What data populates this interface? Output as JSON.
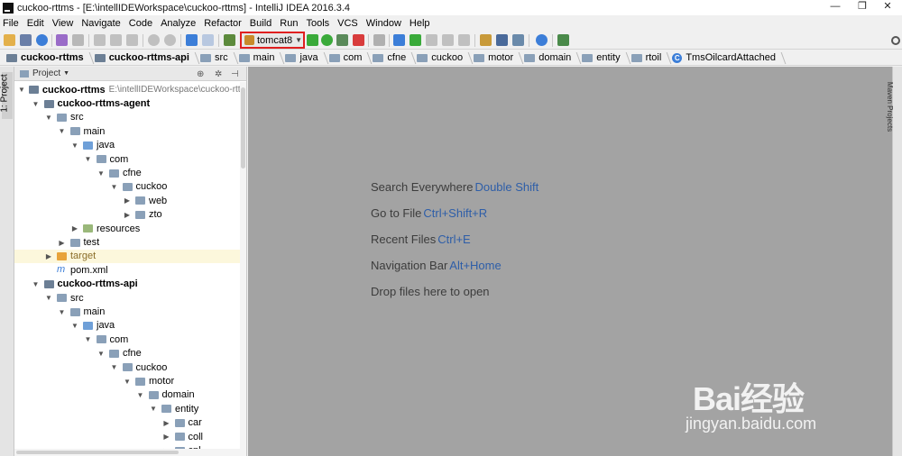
{
  "window": {
    "title": "cuckoo-rttms - [E:\\intellIDEWorkspace\\cuckoo-rttms] - IntelliJ IDEA 2016.3.4",
    "controls": [
      "—",
      "❐",
      "✕"
    ]
  },
  "menu": [
    "File",
    "Edit",
    "View",
    "Navigate",
    "Code",
    "Analyze",
    "Refactor",
    "Build",
    "Run",
    "Tools",
    "VCS",
    "Window",
    "Help"
  ],
  "toolbar": {
    "run_config": "tomcat8",
    "accent": "#e02020"
  },
  "breadcrumbs": [
    {
      "label": "cuckoo-rttms",
      "bold": true,
      "icon": "project-folder-icon"
    },
    {
      "label": "cuckoo-rttms-api",
      "bold": true,
      "icon": "module-folder-icon"
    },
    {
      "label": "src",
      "icon": "folder-icon"
    },
    {
      "label": "main",
      "icon": "folder-icon"
    },
    {
      "label": "java",
      "icon": "source-folder-icon"
    },
    {
      "label": "com",
      "icon": "folder-icon"
    },
    {
      "label": "cfne",
      "icon": "folder-icon"
    },
    {
      "label": "cuckoo",
      "icon": "folder-icon"
    },
    {
      "label": "motor",
      "icon": "folder-icon"
    },
    {
      "label": "domain",
      "icon": "folder-icon"
    },
    {
      "label": "entity",
      "icon": "folder-icon"
    },
    {
      "label": "rtoil",
      "icon": "folder-icon"
    },
    {
      "label": "TmsOilcardAttached",
      "icon": "class-icon"
    }
  ],
  "left_tool_window": {
    "tab_label": "1: Project"
  },
  "project_panel": {
    "header": "Project",
    "tree": [
      {
        "label": "cuckoo-rttms",
        "path": "E:\\intellIDEWorkspace\\cuckoo-rttms",
        "indent": 0,
        "expanded": true,
        "bold": true,
        "icon": "mod"
      },
      {
        "label": "cuckoo-rttms-agent",
        "indent": 1,
        "expanded": true,
        "bold": true,
        "icon": "mod"
      },
      {
        "label": "src",
        "indent": 2,
        "expanded": true,
        "icon": "folder"
      },
      {
        "label": "main",
        "indent": 3,
        "expanded": true,
        "icon": "folder"
      },
      {
        "label": "java",
        "indent": 4,
        "expanded": true,
        "icon": "src"
      },
      {
        "label": "com",
        "indent": 5,
        "expanded": true,
        "icon": "folder"
      },
      {
        "label": "cfne",
        "indent": 6,
        "expanded": true,
        "icon": "folder"
      },
      {
        "label": "cuckoo",
        "indent": 7,
        "expanded": true,
        "icon": "folder"
      },
      {
        "label": "web",
        "indent": 8,
        "expanded": false,
        "icon": "folder"
      },
      {
        "label": "zto",
        "indent": 8,
        "expanded": false,
        "icon": "folder"
      },
      {
        "label": "resources",
        "indent": 4,
        "expanded": false,
        "icon": "res"
      },
      {
        "label": "test",
        "indent": 3,
        "expanded": false,
        "icon": "folder"
      },
      {
        "label": "target",
        "indent": 2,
        "expanded": false,
        "icon": "tgt",
        "highlight": true
      },
      {
        "label": "pom.xml",
        "indent": 2,
        "leaf": true,
        "icon": "maven"
      },
      {
        "label": "cuckoo-rttms-api",
        "indent": 1,
        "expanded": true,
        "bold": true,
        "icon": "mod"
      },
      {
        "label": "src",
        "indent": 2,
        "expanded": true,
        "icon": "folder"
      },
      {
        "label": "main",
        "indent": 3,
        "expanded": true,
        "icon": "folder"
      },
      {
        "label": "java",
        "indent": 4,
        "expanded": true,
        "icon": "src"
      },
      {
        "label": "com",
        "indent": 5,
        "expanded": true,
        "icon": "folder"
      },
      {
        "label": "cfne",
        "indent": 6,
        "expanded": true,
        "icon": "folder"
      },
      {
        "label": "cuckoo",
        "indent": 7,
        "expanded": true,
        "icon": "folder"
      },
      {
        "label": "motor",
        "indent": 8,
        "expanded": true,
        "icon": "folder"
      },
      {
        "label": "domain",
        "indent": 9,
        "expanded": true,
        "icon": "folder"
      },
      {
        "label": "entity",
        "indent": 10,
        "expanded": true,
        "icon": "folder"
      },
      {
        "label": "car",
        "indent": 11,
        "expanded": false,
        "icon": "folder"
      },
      {
        "label": "coll",
        "indent": 11,
        "expanded": false,
        "icon": "folder"
      },
      {
        "label": "cpl",
        "indent": 11,
        "expanded": false,
        "icon": "folder"
      }
    ]
  },
  "editor_hints": [
    {
      "text": "Search Everywhere",
      "key": "Double Shift"
    },
    {
      "text": "Go to File",
      "key": "Ctrl+Shift+R"
    },
    {
      "text": "Recent Files",
      "key": "Ctrl+E"
    },
    {
      "text": "Navigation Bar",
      "key": "Alt+Home"
    },
    {
      "text": "Drop files here to open",
      "key": ""
    }
  ],
  "right_tool_window": {
    "tab_label": "Maven Projects"
  },
  "watermark": {
    "logo": "Bai经验",
    "url": "jingyan.baidu.com"
  }
}
